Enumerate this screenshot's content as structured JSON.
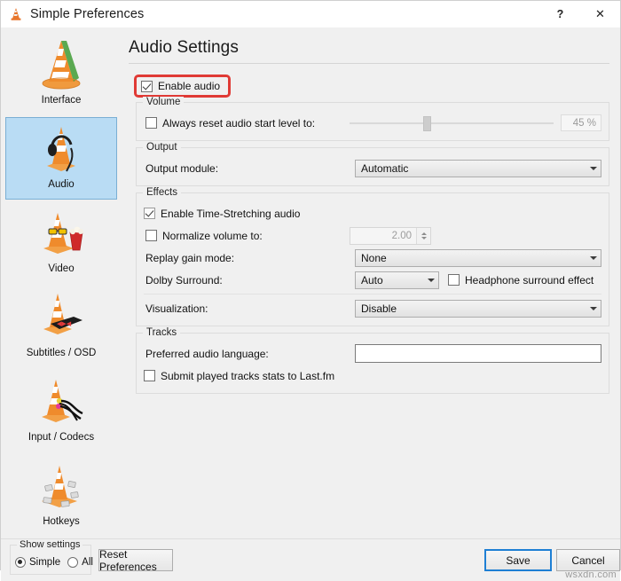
{
  "window": {
    "title": "Simple Preferences",
    "icon": "vlc-cone-icon",
    "help_label": "?",
    "close_label": "✕"
  },
  "sidebar": {
    "items": [
      {
        "label": "Interface",
        "icon": "vlc-cone-plain-icon",
        "selected": false
      },
      {
        "label": "Audio",
        "icon": "vlc-cone-headphones-icon",
        "selected": true
      },
      {
        "label": "Video",
        "icon": "vlc-cone-glasses-popcorn-icon",
        "selected": false
      },
      {
        "label": "Subtitles / OSD",
        "icon": "vlc-cone-marquee-icon",
        "selected": false
      },
      {
        "label": "Input / Codecs",
        "icon": "vlc-cone-cables-icon",
        "selected": false
      },
      {
        "label": "Hotkeys",
        "icon": "vlc-cone-keys-icon",
        "selected": false
      }
    ]
  },
  "main": {
    "page_title": "Audio Settings",
    "enable_audio": {
      "label": "Enable audio",
      "checked": true,
      "highlight_color": "#e03a35"
    },
    "volume_group": {
      "title": "Volume",
      "always_reset_label": "Always reset audio start level to:",
      "always_reset_checked": false,
      "slider_value": 45,
      "slider_value_label": "45 %"
    },
    "output_group": {
      "title": "Output",
      "output_module_label": "Output module:",
      "output_module_value": "Automatic"
    },
    "effects_group": {
      "title": "Effects",
      "time_stretch_label": "Enable Time-Stretching audio",
      "time_stretch_checked": true,
      "normalize_label": "Normalize volume to:",
      "normalize_checked": false,
      "normalize_value": "2.00",
      "replay_gain_label": "Replay gain mode:",
      "replay_gain_value": "None",
      "dolby_label": "Dolby Surround:",
      "dolby_value": "Auto",
      "headphone_label": "Headphone surround effect",
      "headphone_checked": false,
      "visualization_label": "Visualization:",
      "visualization_value": "Disable"
    },
    "tracks_group": {
      "title": "Tracks",
      "preferred_lang_label": "Preferred audio language:",
      "preferred_lang_value": "",
      "lastfm_label": "Submit played tracks stats to Last.fm",
      "lastfm_checked": false
    }
  },
  "footer": {
    "show_settings_title": "Show settings",
    "radio_simple": "Simple",
    "radio_all": "All",
    "radio_selected": "Simple",
    "reset_label": "Reset Preferences",
    "save_label": "Save",
    "cancel_label": "Cancel",
    "watermark": "wsxdn.com"
  }
}
